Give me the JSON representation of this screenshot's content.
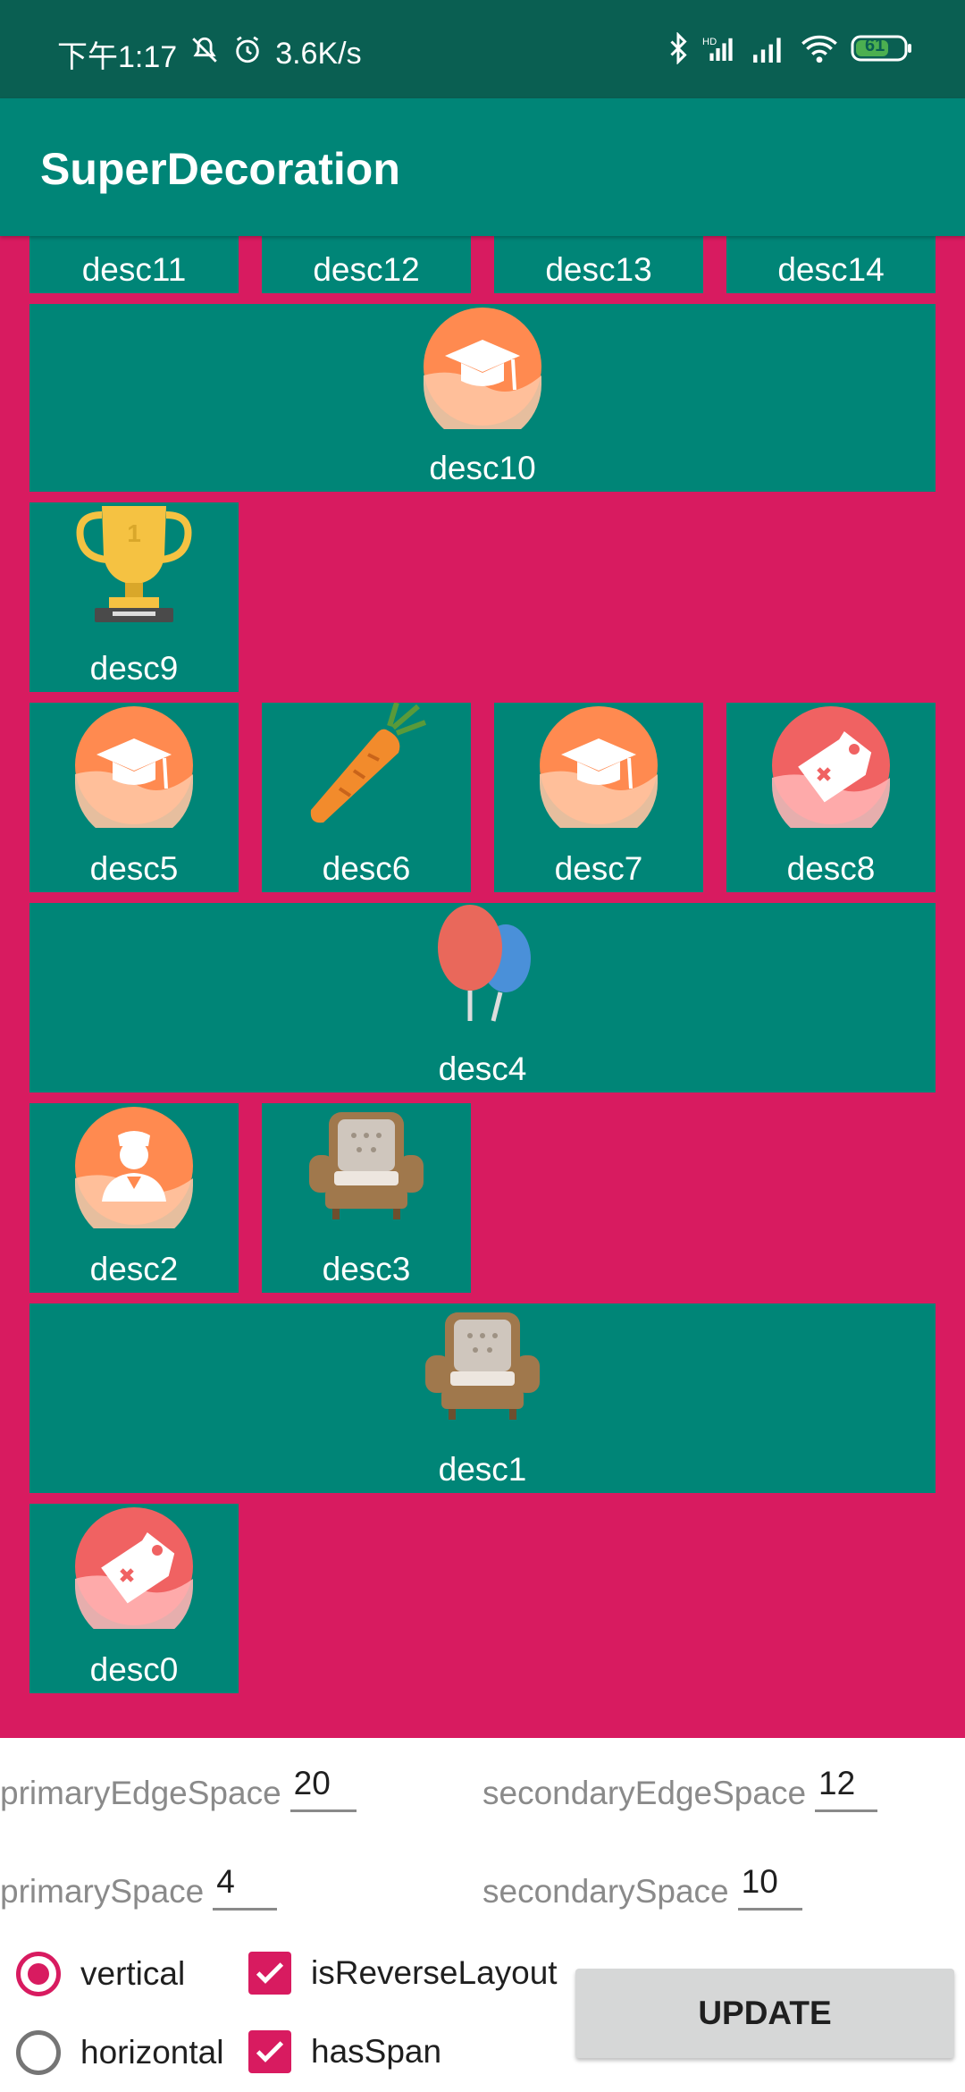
{
  "status_bar": {
    "time": "下午1:17",
    "net_speed": "3.6K/s",
    "battery": "61",
    "icons": [
      "mute-icon",
      "alarm-icon",
      "bluetooth-icon",
      "hd-signal-icon",
      "signal-icon",
      "wifi-icon",
      "battery-icon"
    ]
  },
  "app_bar": {
    "title": "SuperDecoration"
  },
  "grid": {
    "items": [
      {
        "label": "desc11",
        "icon": "none"
      },
      {
        "label": "desc12",
        "icon": "none"
      },
      {
        "label": "desc13",
        "icon": "none"
      },
      {
        "label": "desc14",
        "icon": "none"
      },
      {
        "label": "desc10",
        "icon": "graduation-cap-icon"
      },
      {
        "label": "desc9",
        "icon": "trophy-icon"
      },
      {
        "label": "desc5",
        "icon": "graduation-cap-icon"
      },
      {
        "label": "desc6",
        "icon": "carrot-icon"
      },
      {
        "label": "desc7",
        "icon": "graduation-cap-icon"
      },
      {
        "label": "desc8",
        "icon": "price-tag-icon"
      },
      {
        "label": "desc4",
        "icon": "balloons-icon"
      },
      {
        "label": "desc2",
        "icon": "nurse-icon"
      },
      {
        "label": "desc3",
        "icon": "armchair-icon"
      },
      {
        "label": "desc1",
        "icon": "armchair-icon"
      },
      {
        "label": "desc0",
        "icon": "price-tag-icon"
      }
    ]
  },
  "controls": {
    "primary_edge_space": {
      "label": "primaryEdgeSpace",
      "value": "20"
    },
    "secondary_edge_space": {
      "label": "secondaryEdgeSpace",
      "value": "12"
    },
    "primary_space": {
      "label": "primarySpace",
      "value": "4"
    },
    "secondary_space": {
      "label": "secondarySpace",
      "value": "10"
    },
    "orientation_vertical": {
      "label": "vertical",
      "selected": true
    },
    "orientation_horizontal": {
      "label": "horizontal",
      "selected": false
    },
    "is_reverse_layout": {
      "label": "isReverseLayout",
      "checked": true
    },
    "has_span": {
      "label": "hasSpan",
      "checked": true
    },
    "update_label": "UPDATE"
  },
  "colors": {
    "status_bar": "#0a5f52",
    "app_bar": "#008577",
    "cell": "#008577",
    "accent": "#d81b60",
    "button": "#d6d7d7"
  }
}
